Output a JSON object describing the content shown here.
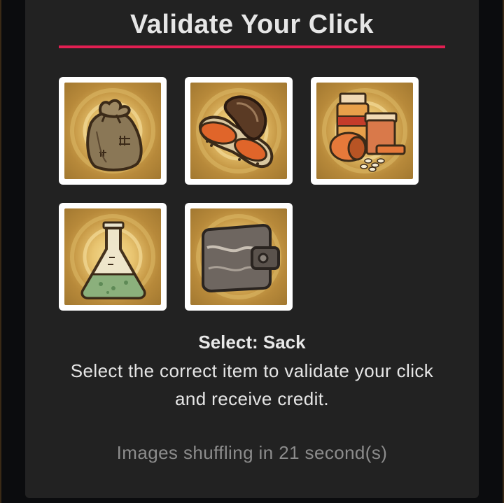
{
  "captcha": {
    "title": "Validate Your Click",
    "select_prefix": "Select:",
    "select_target": "Sack",
    "instructions": "Select the correct item to validate your click and receive credit.",
    "shuffle_text": "Images shuffling in 21 second(s)"
  },
  "tiles": [
    {
      "icon": "sack-icon"
    },
    {
      "icon": "peanut-icon"
    },
    {
      "icon": "medicine-bottles-icon"
    },
    {
      "icon": "flask-icon"
    },
    {
      "icon": "wallet-icon"
    }
  ],
  "colors": {
    "accent": "#e21f52",
    "panel": "#222222",
    "background": "#0b0c0e",
    "text": "#e6e6e6",
    "muted_text": "#8c8c8c"
  }
}
